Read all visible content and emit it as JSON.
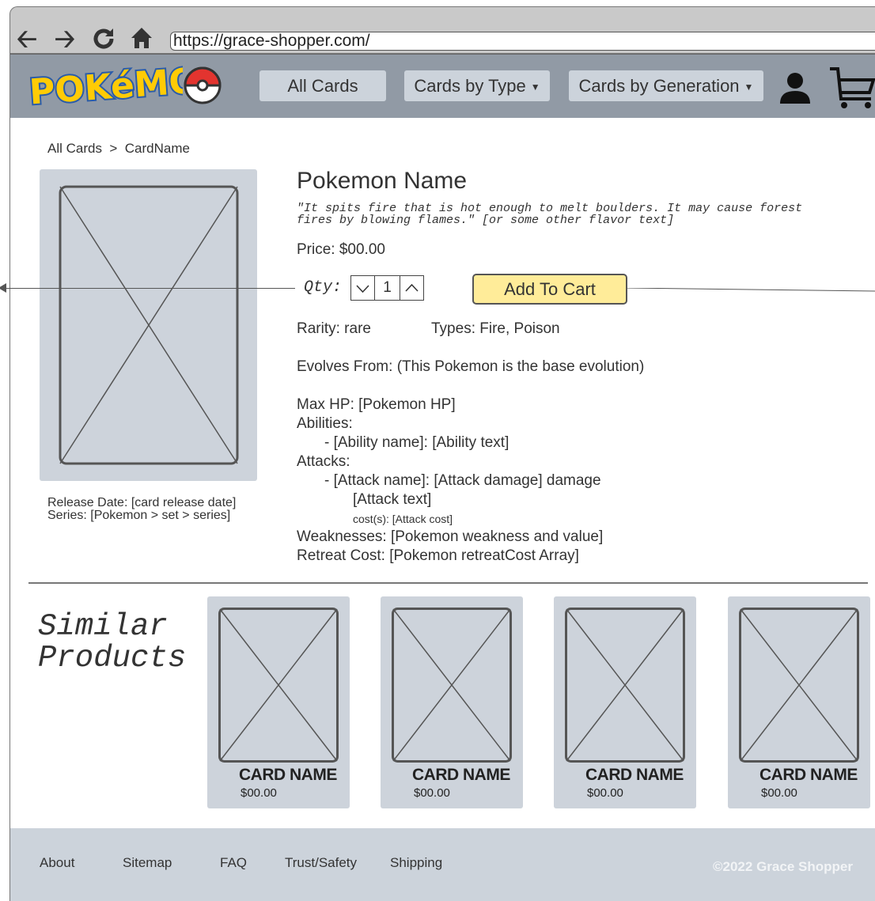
{
  "browser": {
    "back_icon": "arrow-left-icon",
    "forward_icon": "arrow-right-icon",
    "reload_icon": "reload-icon",
    "home_icon": "home-icon",
    "url": "https://grace-shopper.com/"
  },
  "header": {
    "logo_text": "POKéMON",
    "nav": {
      "all_cards": "All Cards",
      "cards_by_type": "Cards by Type",
      "cards_by_generation": "Cards by Generation"
    }
  },
  "breadcrumb": "All Cards  >  CardName",
  "product": {
    "name": "Pokemon Name",
    "flavor_line1": "\"It spits fire that is hot enough to melt boulders. It may cause forest",
    "flavor_line2": "fires by blowing flames.\" [or some other flavor text]",
    "price": "Price: $00.00",
    "qty_label": "Qty:",
    "qty_value": "1",
    "add_to_cart": "Add To Cart",
    "rarity": "Rarity: rare",
    "types": "Types: Fire, Poison",
    "evolves_from": "Evolves From: (This Pokemon is the base evolution)",
    "max_hp": "Max HP: [Pokemon HP]",
    "abilities_label": "Abilities:",
    "ability": "- [Ability name]: [Ability text]",
    "attacks_label": "Attacks:",
    "attack": "- [Attack name]: [Attack damage] damage",
    "attack_text": "[Attack text]",
    "attack_cost": "cost(s): [Attack cost]",
    "weaknesses": "Weaknesses: [Pokemon weakness and value]",
    "retreat_cost": "Retreat Cost: [Pokemon retreatCost Array]",
    "release_date": "Release Date: [card release date]",
    "series": "Series: [Pokemon > set > series]"
  },
  "similar": {
    "title_line1": "Similar",
    "title_line2": "Products",
    "cards": [
      {
        "name": "CARD NAME",
        "price": "$00.00"
      },
      {
        "name": "CARD NAME",
        "price": "$00.00"
      },
      {
        "name": "CARD NAME",
        "price": "$00.00"
      },
      {
        "name": "CARD NAME",
        "price": "$00.00"
      }
    ]
  },
  "footer": {
    "links": [
      "About",
      "Sitemap",
      "FAQ",
      "Trust/Safety",
      "Shipping"
    ],
    "copyright": "©2022 Grace Shopper"
  }
}
